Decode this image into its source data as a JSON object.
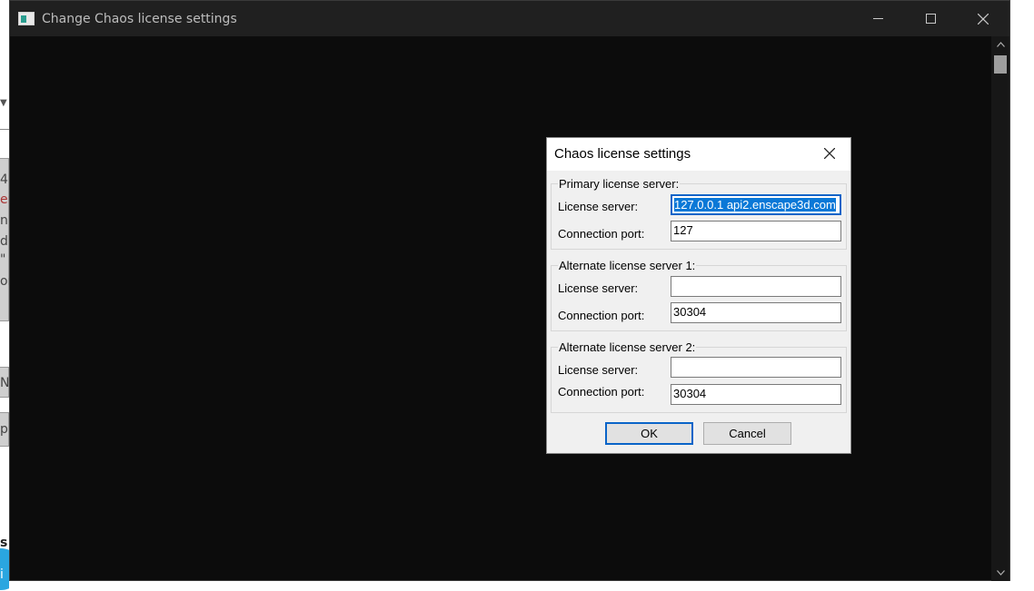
{
  "background_window": {
    "fragments": [
      "4",
      "er",
      "n",
      "d",
      "\"",
      "or",
      "N",
      "p",
      "s",
      "i"
    ]
  },
  "console": {
    "title": "Change Chaos license settings",
    "controls": {
      "minimize_icon": "minimize-icon",
      "maximize_icon": "maximize-icon",
      "close_icon": "close-icon"
    }
  },
  "dialog": {
    "title": "Chaos license settings",
    "groups": [
      {
        "title": "Primary license server:",
        "server_label": "License server:",
        "server_value": "127.0.0.1 api2.enscape3d.com",
        "port_label": "Connection port:",
        "port_value": "127"
      },
      {
        "title": "Alternate license server 1:",
        "server_label": "License server:",
        "server_value": "",
        "port_label": "Connection port:",
        "port_value": "30304"
      },
      {
        "title": "Alternate license server 2:",
        "server_label": "License server:",
        "server_value": "",
        "port_label": "Connection port:",
        "port_value": "30304"
      }
    ],
    "ok_label": "OK",
    "cancel_label": "Cancel"
  },
  "colors": {
    "console_bg": "#0c0c0c",
    "titlebar_bg": "#202020",
    "selection": "#0a78d7",
    "focus_border": "#0a64c8"
  }
}
